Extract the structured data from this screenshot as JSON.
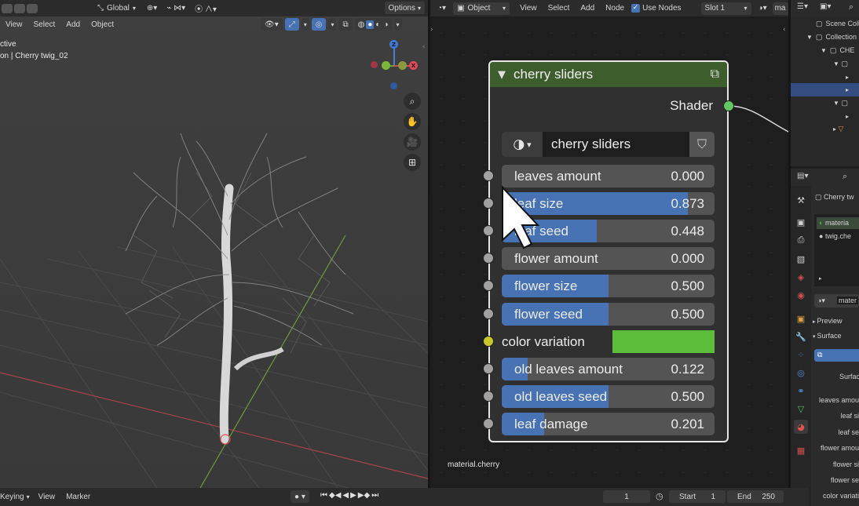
{
  "viewport": {
    "header": {
      "transform_orientation": "Global",
      "options_label": "Options"
    },
    "menu": [
      "View",
      "Select",
      "Add",
      "Object"
    ],
    "overlay_text": {
      "mode": "ctive",
      "object_name": "on | Cherry twig_02"
    },
    "gizmo": {
      "z": "Z",
      "x": "X"
    },
    "nav_icons": [
      "zoom-icon",
      "hand-icon",
      "camera-icon",
      "grid-icon"
    ]
  },
  "node_editor": {
    "header": {
      "object_mode": "Object",
      "menu": [
        "View",
        "Select",
        "Add",
        "Node"
      ],
      "use_nodes_label": "Use Nodes",
      "slot": "Slot 1",
      "material_short": "ma"
    },
    "material_label": "material.cherry",
    "node": {
      "title": "cherry sliders",
      "output": "Shader",
      "group_name": "cherry sliders",
      "sliders": [
        {
          "label": "leaves amount",
          "value": "0.000",
          "fraction": 0.0
        },
        {
          "label": "leaf size",
          "value": "0.873",
          "fraction": 0.873
        },
        {
          "label": "leaf seed",
          "value": "0.448",
          "fraction": 0.448
        },
        {
          "label": "flower amount",
          "value": "0.000",
          "fraction": 0.0
        },
        {
          "label": "flower size",
          "value": "0.500",
          "fraction": 0.5
        },
        {
          "label": "flower seed",
          "value": "0.500",
          "fraction": 0.5
        },
        {
          "label": "color variation",
          "value": "",
          "fraction": 0,
          "color": "#5cbd3b"
        },
        {
          "label": "old leaves amount",
          "value": "0.122",
          "fraction": 0.122
        },
        {
          "label": "old leaves seed",
          "value": "0.500",
          "fraction": 0.5
        },
        {
          "label": "leaf damage",
          "value": "0.201",
          "fraction": 0.201
        }
      ]
    }
  },
  "outliner": {
    "rows": [
      "Scene Colle",
      "Collection",
      "CHE"
    ]
  },
  "properties": {
    "object_name": "Cherry tw",
    "slots": [
      "materia",
      "twig.che"
    ],
    "material_field": "mater",
    "sections": [
      "Preview",
      "Surface"
    ],
    "surface_label": "Surfac",
    "inputs": [
      "leaves amou",
      "leaf si",
      "leaf se",
      "flower amou",
      "flower si",
      "flower se",
      "color variati"
    ]
  },
  "timeline": {
    "keying": "Keying",
    "menu": [
      "View",
      "Marker"
    ],
    "current_frame": "1",
    "start_label": "Start",
    "start": "1",
    "end_label": "End",
    "end": "250"
  },
  "colors": {
    "accent_blue": "#4772b3",
    "node_header": "#3d5e2c",
    "shader_socket": "#63c763",
    "color_socket": "#c7c729"
  }
}
